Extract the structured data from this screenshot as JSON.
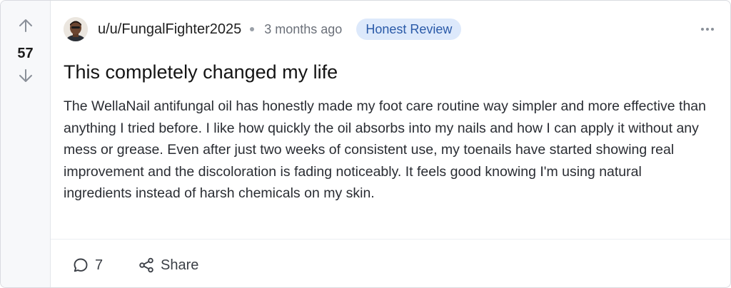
{
  "post": {
    "votes": "57",
    "author": "u/u/FungalFighter2025",
    "time_ago": "3 months ago",
    "flair": "Honest Review",
    "title": "This completely changed my life",
    "body": "The WellaNail antifungal oil has honestly made my foot care routine way simpler and more effective than anything I tried before. I like how quickly the oil absorbs into my nails and how I can apply it without any mess or grease. Even after just two weeks of consistent use, my toenails have started showing real improvement and the discoloration is fading noticeably. It feels good knowing I'm using natural ingredients instead of harsh chemicals on my skin."
  },
  "actions": {
    "comments_count": "7",
    "share_label": "Share"
  },
  "icons": {
    "upvote": "arrow-up-icon",
    "downvote": "arrow-down-icon",
    "more": "more-horizontal-icon",
    "comment": "comment-bubble-icon",
    "share": "share-icon"
  },
  "colors": {
    "flair_bg": "#dde9fb",
    "flair_text": "#2a5aa8",
    "rail_bg": "#f7f8fa"
  }
}
